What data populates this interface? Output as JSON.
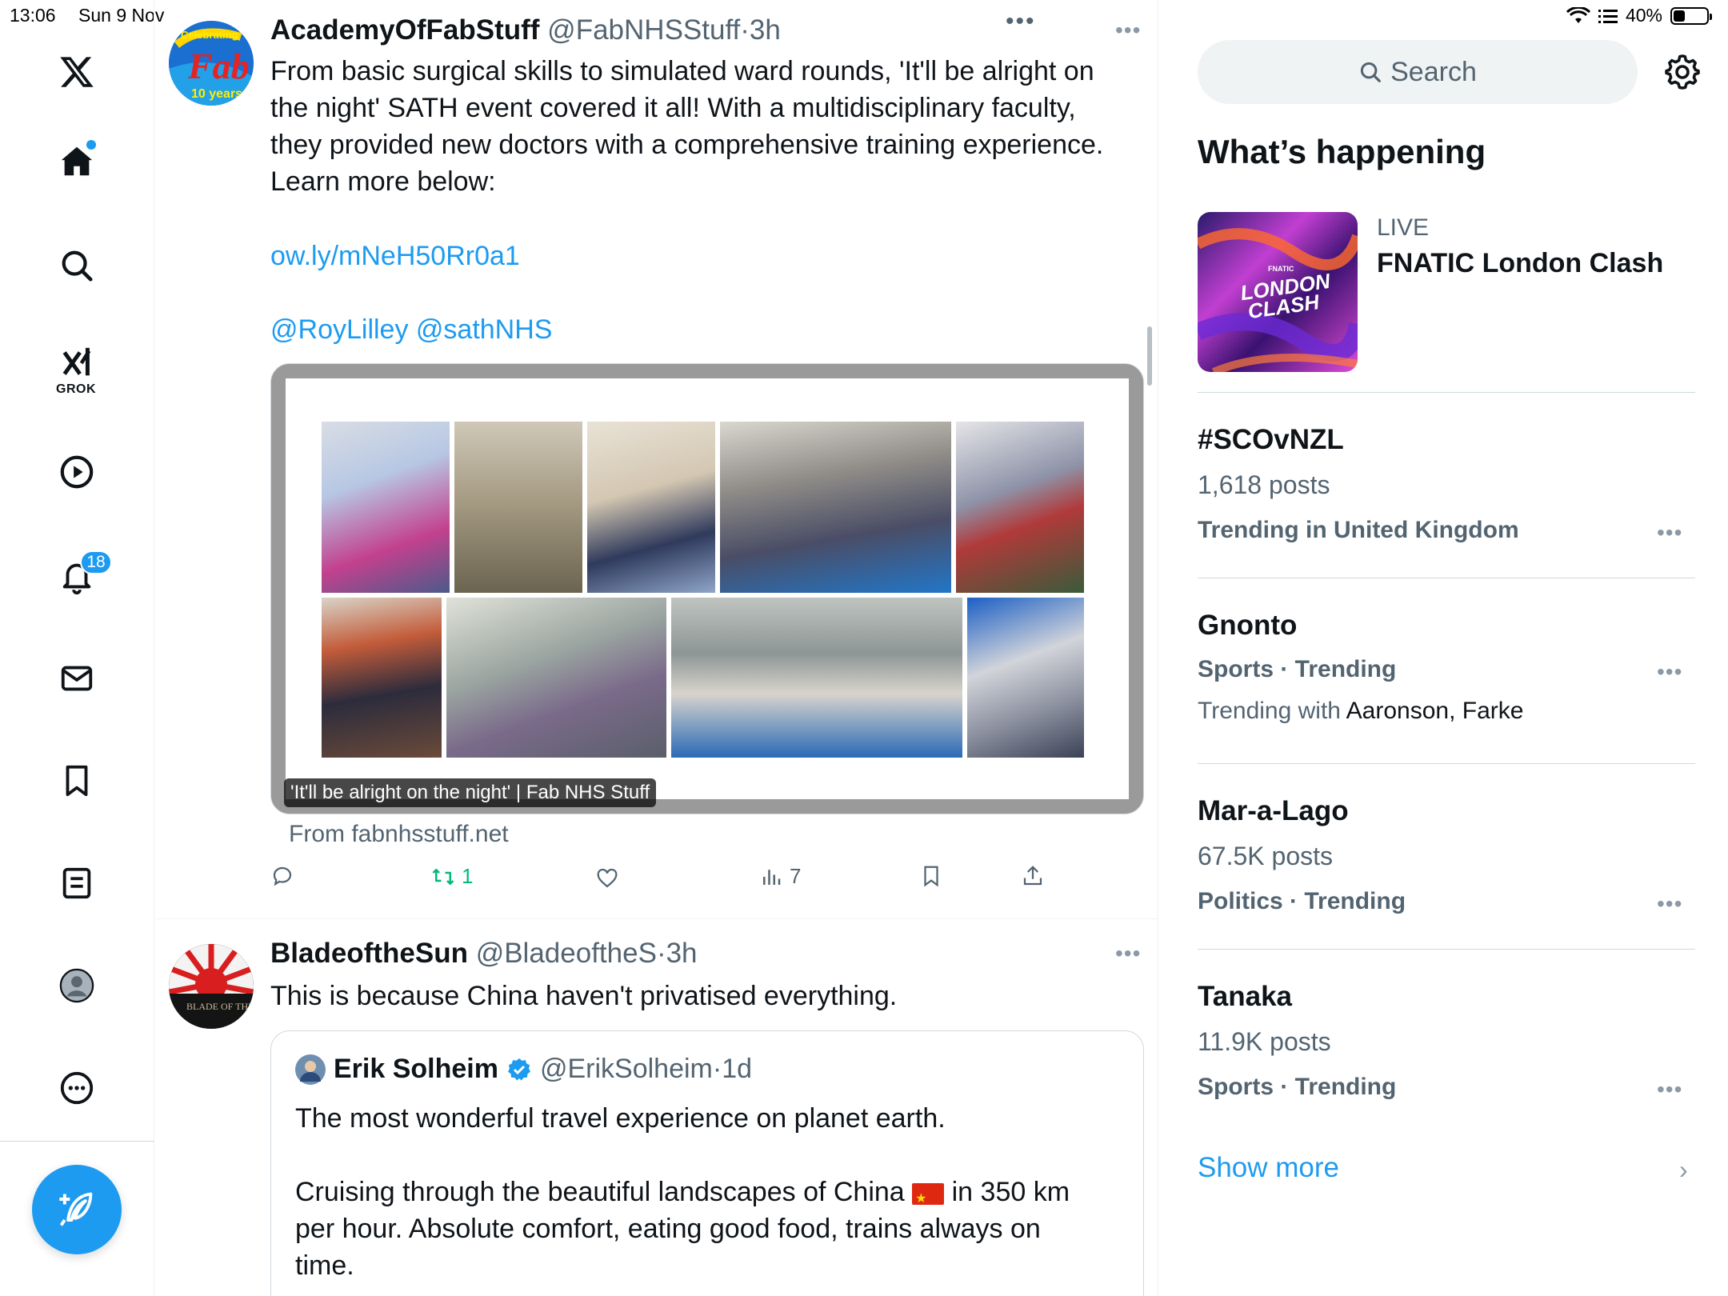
{
  "status_bar": {
    "time": "13:06",
    "date": "Sun 9 Nov",
    "battery": "40%",
    "battery_level": 0.4
  },
  "nav": {
    "items": [
      {
        "name": "home",
        "label": "Home"
      },
      {
        "name": "explore",
        "label": "Explore"
      },
      {
        "name": "grok",
        "label": "GROK"
      },
      {
        "name": "videos",
        "label": "Videos"
      },
      {
        "name": "notifications",
        "label": "Notifications"
      },
      {
        "name": "messages",
        "label": "Messages"
      },
      {
        "name": "bookmarks",
        "label": "Bookmarks"
      },
      {
        "name": "lists",
        "label": "Lists"
      },
      {
        "name": "profile",
        "label": "Profile"
      },
      {
        "name": "more",
        "label": "More"
      }
    ],
    "grok_label": "GROK",
    "notifications_badge": "18"
  },
  "feed": {
    "tweets": [
      {
        "name": "AcademyOfFabStuff",
        "handle": "@FabNHSStuff",
        "time": "3h",
        "text_lines": [
          "From basic surgical skills to simulated ward rounds, 'It'll be alright on",
          "the night' SATH event covered it all! With a multidisciplinary faculty,",
          "they provided new doctors with a comprehensive training experience.",
          "Learn more below:"
        ],
        "link": "ow.ly/mNeH50Rr0a1",
        "mentions": "@RoyLilley @sathNHS",
        "card_caption": "'It'll be alright on the night' | Fab NHS Stuff",
        "card_source": "From fabnhsstuff.net",
        "avatar_text_1": "Celebrating",
        "avatar_text_2": "Fab",
        "avatar_text_3": "10 years",
        "stats": {
          "replies": "",
          "retweets": "1",
          "likes": "",
          "views": "7"
        }
      },
      {
        "name": "BladeoftheSun",
        "handle": "@BladeoftheS",
        "time": "3h",
        "text": "This is because China haven't privatised everything.",
        "avatar_text": "BLADE OF THE",
        "quote": {
          "name": "Erik Solheim",
          "handle": "@ErikSolheim",
          "time": "1d",
          "line1": "The most wonderful travel experience on planet earth.",
          "line2a": "Cruising through the beautiful landscapes of China",
          "line2b": "in 350 km",
          "line3": "per hour. Absolute comfort, eating good food, trains always on",
          "line4": "time."
        }
      }
    ]
  },
  "right": {
    "search_placeholder": "Search",
    "whats_happening": "What’s happening",
    "live": {
      "label": "LIVE",
      "title": "FNATIC London Clash",
      "thumb_text_1": "LONDON",
      "thumb_text_2": "CLASH",
      "thumb_text_small": "FNATIC"
    },
    "trends": [
      {
        "name": "#SCOvNZL",
        "posts": "1,618 posts",
        "context": "Trending in United Kingdom"
      },
      {
        "name": "Gnonto",
        "context": "Sports · Trending",
        "with_prefix": "Trending with",
        "with": "Aaronson, Farke"
      },
      {
        "name": "Mar-a-Lago",
        "posts": "67.5K posts",
        "context": "Politics · Trending"
      },
      {
        "name": "Tanaka",
        "posts": "11.9K posts",
        "context": "Sports · Trending"
      }
    ],
    "show_more": "Show more"
  },
  "colors": {
    "accent": "#1d9bf0",
    "retweet_green": "#00ba7c",
    "text_secondary": "#536471"
  }
}
